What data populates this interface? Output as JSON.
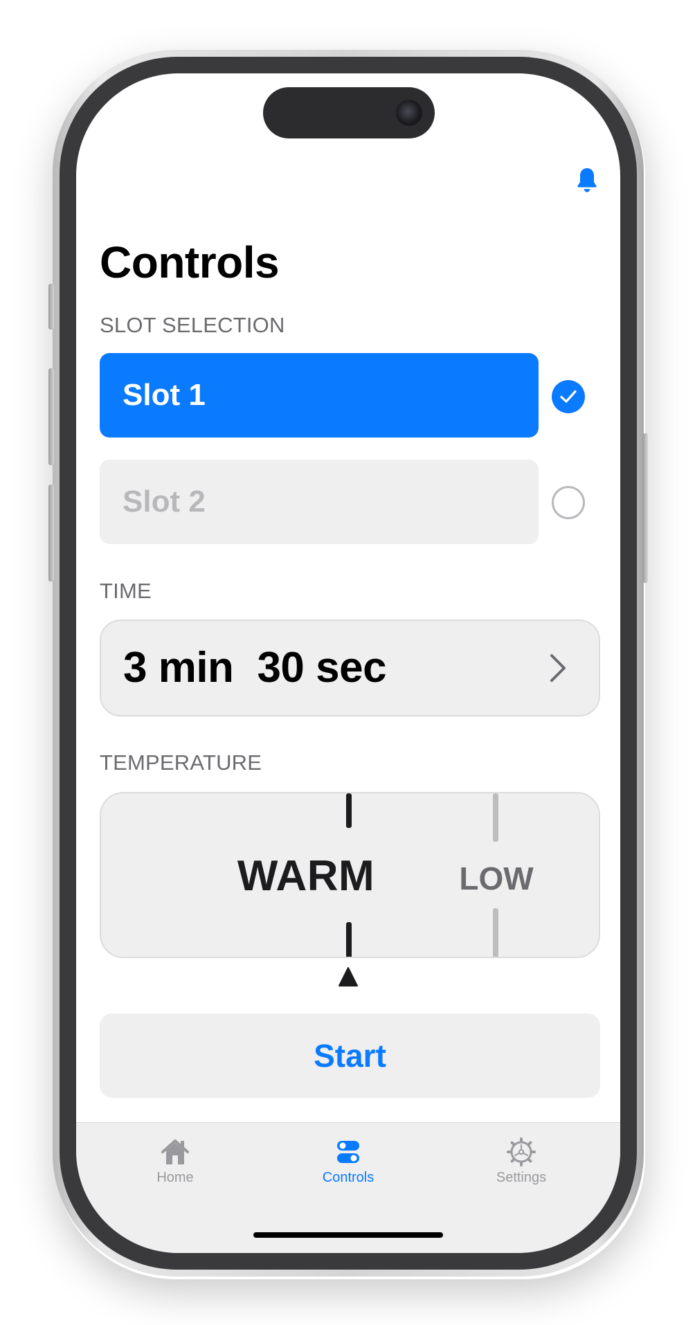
{
  "screen": {
    "title": "Controls"
  },
  "slot_selection": {
    "label": "SLOT SELECTION",
    "slots": [
      {
        "label": "Slot 1",
        "selected": true
      },
      {
        "label": "Slot 2",
        "selected": false
      }
    ]
  },
  "time": {
    "label": "TIME",
    "minutes": "3 min",
    "seconds": "30 sec"
  },
  "temperature": {
    "label": "TEMPERATURE",
    "selected": "WARM",
    "next_option": "LOW"
  },
  "start_button": {
    "label": "Start"
  },
  "tab_bar": {
    "tabs": [
      {
        "label": "Home",
        "icon": "house-icon",
        "active": false
      },
      {
        "label": "Controls",
        "icon": "toggles-icon",
        "active": true
      },
      {
        "label": "Settings",
        "icon": "gear-icon",
        "active": false
      }
    ]
  },
  "colors": {
    "accent": "#0a7aff",
    "inactive": "#9a9a9e",
    "field_bg": "#efefef"
  },
  "icons": {
    "notification": "bell-icon",
    "radio_checked": "checkmark-icon",
    "disclosure": "chevron-right-icon",
    "dial_marker": "triangle-up-icon"
  }
}
